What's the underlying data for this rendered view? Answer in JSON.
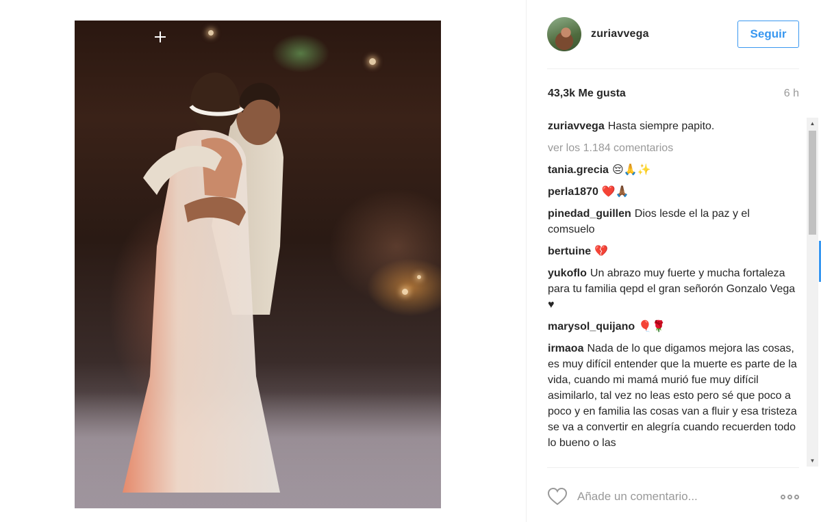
{
  "post": {
    "photo_alt": "Wedding dance photo: bride in white gown embracing man in light suit",
    "author": {
      "username": "zuriavvega"
    },
    "follow_label": "Seguir",
    "likes": "43,3k Me gusta",
    "time_ago": "6 h",
    "caption": {
      "username": "zuriavvega",
      "text": "Hasta siempre papito."
    },
    "view_comments_label": "ver los 1.184 comentarios",
    "comments": [
      {
        "username": "tania.grecia",
        "text": "😔🙏✨"
      },
      {
        "username": "perla1870",
        "text": "❤️🙏🏾"
      },
      {
        "username": "pinedad_guillen",
        "text": "Dios lesde el la paz y el comsuelo"
      },
      {
        "username": "bertuine",
        "text": "💔"
      },
      {
        "username": "yukoflo",
        "text": "Un abrazo muy fuerte y mucha fortaleza para tu familia qepd el gran señorón Gonzalo Vega ♥"
      },
      {
        "username": "marysol_quijano",
        "text": "🎈🌹"
      },
      {
        "username": "irmaoa",
        "text": "Nada de lo que digamos mejora las cosas, es muy difícil entender que la muerte es parte de la vida, cuando mi mamá murió fue muy difícil asimilarlo, tal vez no leas esto pero sé que poco a poco y en familia las cosas van a fluir y esa tristeza se va a convertir en alegría cuando recuerden todo lo bueno o las"
      }
    ],
    "add_comment_placeholder": "Añade un comentario...",
    "icons": {
      "like": "heart-outline-icon",
      "options": "more-options-icon"
    },
    "colors": {
      "accent": "#3897f0",
      "text": "#262626",
      "muted": "#999999"
    }
  }
}
